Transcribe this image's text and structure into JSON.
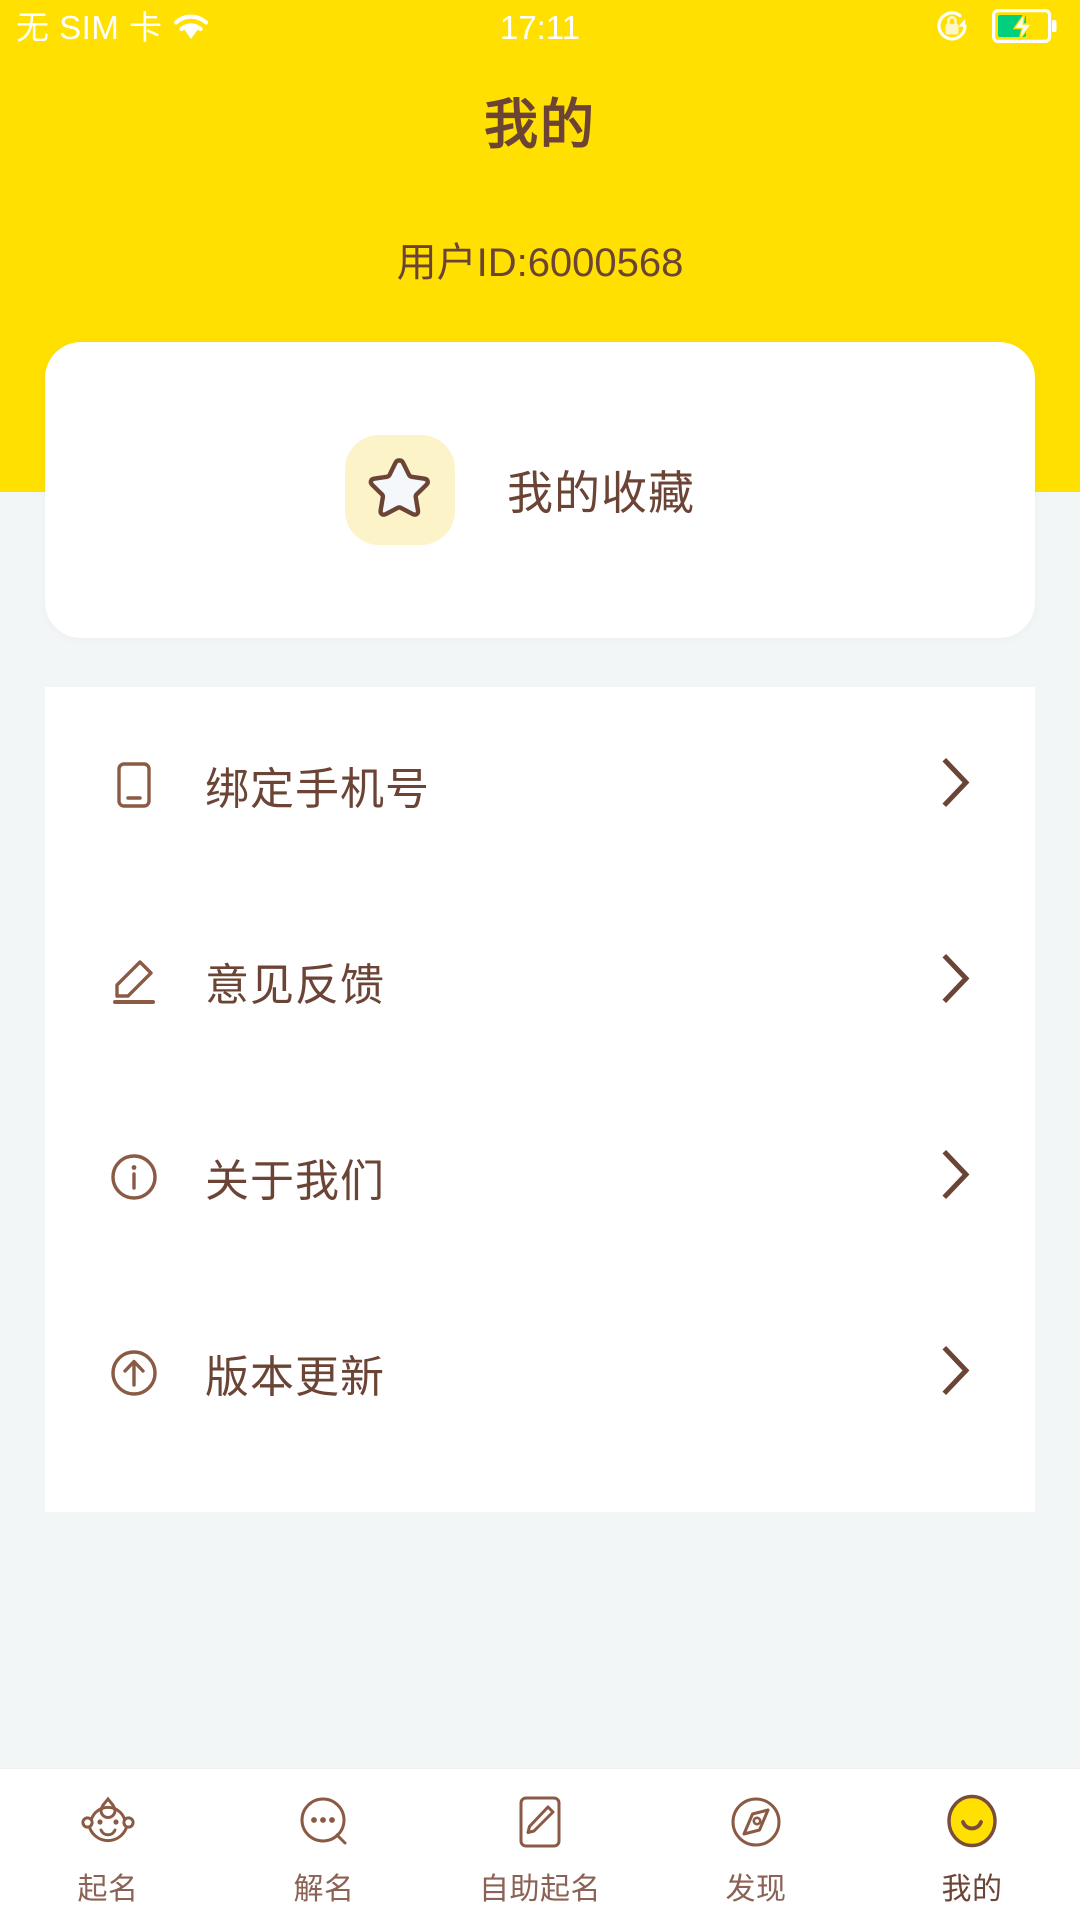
{
  "status_bar": {
    "carrier": "无 SIM 卡",
    "wifi_icon": "wifi-icon",
    "time": "17:11",
    "rotation_lock_icon": "rotation-lock-icon",
    "battery_icon": "battery-charging-icon",
    "battery_level_percent": 55,
    "text_color": "#ffffff",
    "battery_fill_color": "#00d07d"
  },
  "theme": {
    "accent_yellow": "#ffe000",
    "brand_brown": "#6b4436",
    "page_background": "#f2f6f7",
    "card_background": "#ffffff",
    "icon_tile_yellow": "#fcf4c8"
  },
  "header": {
    "title": "我的",
    "user_id_label": "用户ID:6000568"
  },
  "favorites": {
    "icon": "star-icon",
    "label": "我的收藏"
  },
  "menu": {
    "items": [
      {
        "icon": "phone-icon",
        "label": "绑定手机号",
        "chevron": "chevron-right-icon"
      },
      {
        "icon": "pencil-edit-icon",
        "label": "意见反馈",
        "chevron": "chevron-right-icon"
      },
      {
        "icon": "info-circle-icon",
        "label": "关于我们",
        "chevron": "chevron-right-icon"
      },
      {
        "icon": "arrow-up-circle-icon",
        "label": "版本更新",
        "chevron": "chevron-right-icon"
      }
    ]
  },
  "tab_bar": {
    "active_index": 4,
    "items": [
      {
        "icon": "baby-face-icon",
        "label": "起名"
      },
      {
        "icon": "chat-bubble-icon",
        "label": "解名"
      },
      {
        "icon": "note-pencil-icon",
        "label": "自助起名"
      },
      {
        "icon": "compass-icon",
        "label": "发现"
      },
      {
        "icon": "smiley-face-icon",
        "label": "我的"
      }
    ]
  }
}
